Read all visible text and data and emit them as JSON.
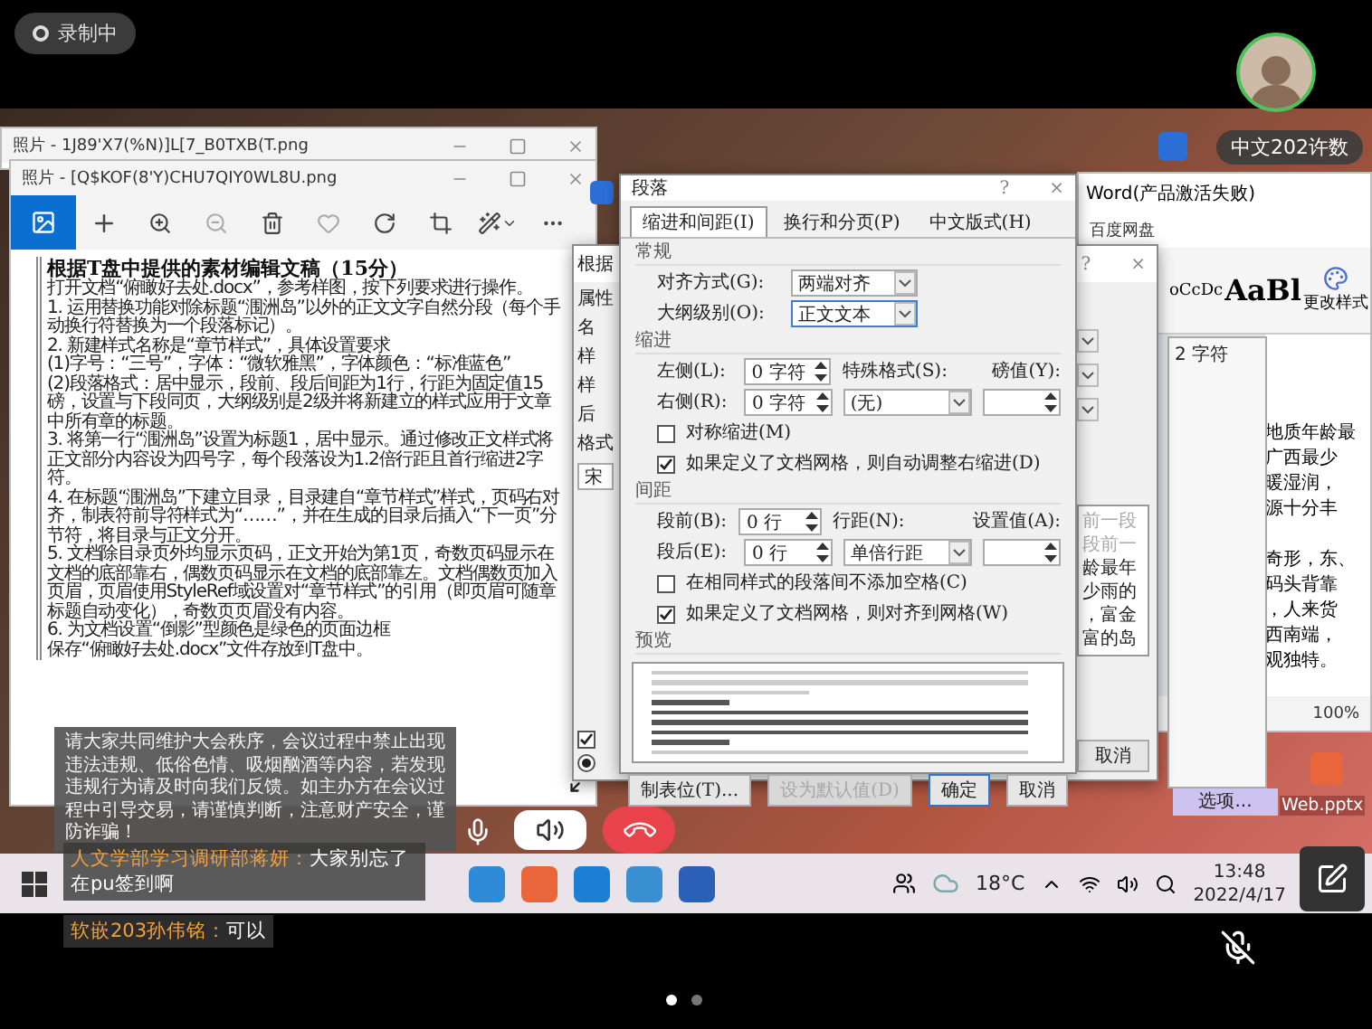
{
  "recording": {
    "label": "录制中"
  },
  "participant": {
    "name": "中文202许数"
  },
  "photo_windows": [
    {
      "title": "照片 - 1J89'X7(%N)]L[7_B0TXB(T.png"
    },
    {
      "title": "照片 - [Q$KOF(8'Y)CHU7QIY0WL8U.png"
    }
  ],
  "document": {
    "heading": "根据T盘中提供的素材编辑文稿（15分）",
    "lines": [
      "打开文档“俯瞰好去处.docx”，参考样图，按下列要求进行操作。",
      "1. 运用替换功能对除标题“涠洲岛”以外的正文文字自然分段（每个手动换行符替换为一个段落标记）。",
      "2. 新建样式名称是“章节样式”，具体设置要求",
      "(1)字号：“三号”，字体：“微软雅黑”，字体颜色：“标准蓝色”",
      "(2)段落格式：居中显示，段前、段后间距为1行，行距为固定值15磅，设置与下段同页，大纲级别是2级并将新建立的样式应用于文章中所有章的标题。",
      "3. 将第一行“涠洲岛”设置为标题1，居中显示。通过修改正文样式将正文部分内容设为四号字，每个段落设为1.2倍行距且首行缩进2字符。",
      "4. 在标题“涠洲岛”下建立目录，目录建自“章节样式”样式，页码右对齐，制表符前导符样式为“……”，并在生成的目录后插入“下一页”分节符，将目录与正文分开。",
      "5. 文档除目录页外均显示页码，正文开始为第1页，奇数页码显示在文档的底部靠右，偶数页码显示在文档的底部靠左。文档偶数页加入页眉，页眉使用StyleRef域设置对“章节样式”的引用（即页眉可随章标题自动变化），奇数页页眉没有内容。",
      "6. 为文档设置“倒影”型颜色是绿色的页面边框",
      "保存“俯瞰好去处.docx”文件存放到T盘中。"
    ]
  },
  "notice": {
    "text": "请大家共同维护大会秩序，会议过程中禁止出现违法违规、低俗色情、吸烟酗酒等内容，若发现违规行为请及时向我们反馈。如主办方在会议过程中引导交易，请谨慎判断，注意财产安全，谨防诈骗！"
  },
  "style_dialog": {
    "title": "根据",
    "labels": [
      "属性",
      "名",
      "样",
      "样",
      "后",
      "格式"
    ],
    "font_value": "宋",
    "help": "?",
    "close": "×",
    "preview_lines": [
      {
        "text": "前一段",
        "muted": true
      },
      {
        "text": "段前一",
        "muted": true
      },
      {
        "text": "龄最年",
        "muted": false
      },
      {
        "text": "少雨的",
        "muted": false
      },
      {
        "text": "，富金",
        "muted": false
      },
      {
        "text": "富的岛",
        "muted": false
      }
    ],
    "add_checked": true,
    "radio_selected": true,
    "cancel": "取消"
  },
  "dialog": {
    "title": "段落",
    "help": "?",
    "close": "×",
    "tabs": [
      {
        "label": "缩进和间距(I)",
        "selected": true
      },
      {
        "label": "换行和分页(P)",
        "selected": false
      },
      {
        "label": "中文版式(H)",
        "selected": false
      }
    ],
    "general": {
      "heading": "常规",
      "alignment": {
        "label": "对齐方式(G):",
        "value": "两端对齐"
      },
      "outline_level": {
        "label": "大纲级别(O):",
        "value": "正文文本"
      }
    },
    "indent": {
      "heading": "缩进",
      "left": {
        "label": "左侧(L):",
        "value": "0 字符"
      },
      "right": {
        "label": "右侧(R):",
        "value": "0 字符"
      },
      "special": {
        "label": "特殊格式(S):",
        "value": "(无)"
      },
      "by": {
        "label": "磅值(Y):"
      },
      "checkboxes": [
        {
          "label": "对称缩进(M)",
          "checked": false
        },
        {
          "label": "如果定义了文档网格，则自动调整右缩进(D)",
          "checked": true
        }
      ]
    },
    "spacing": {
      "heading": "间距",
      "before": {
        "label": "段前(B):",
        "value": "0 行"
      },
      "after": {
        "label": "段后(E):",
        "value": "0 行"
      },
      "line_spacing": {
        "label": "行距(N):",
        "value": "单倍行距"
      },
      "at": {
        "label": "设置值(A):"
      },
      "checkboxes": [
        {
          "label": "在相同样式的段落间不添加空格(C)",
          "checked": false
        },
        {
          "label": "如果定义了文档网格，则对齐到网格(W)",
          "checked": true
        }
      ]
    },
    "preview": {
      "heading": "预览"
    },
    "buttons": [
      {
        "label": "制表位(T)...",
        "disabled": false,
        "default": false
      },
      {
        "label": "设为默认值(D)",
        "disabled": true,
        "default": false
      },
      {
        "label": "确定",
        "disabled": false,
        "default": true
      },
      {
        "label": "取消",
        "disabled": false,
        "default": false
      }
    ]
  },
  "word": {
    "title": "Word(产品激活失败)",
    "ribbon_tab": "百度网盘",
    "styles": [
      "oCcDc",
      "AaBl"
    ],
    "change_styles": "更改样式",
    "pane_value": "2 字符",
    "pane_option": "选项...",
    "zoom": "100%",
    "body_paragraphs": [
      [
        "地质年龄最",
        "广西最少",
        "暖湿润，",
        "源十分丰"
      ],
      [
        "奇形，东、",
        "码头背靠",
        "，人来货",
        "西南端，",
        "观独特。"
      ]
    ]
  },
  "desktop_file": {
    "name": "Web.pptx"
  },
  "chat": [
    {
      "sender": "人文学部学习调研部蒋妍：",
      "text": "大家别忘了在pu签到啊"
    },
    {
      "sender": "软嵌203孙伟铭：",
      "text": "可以"
    }
  ],
  "taskbar": {
    "weather": "18°C",
    "time": "13:48",
    "date": "2022/4/17"
  },
  "pages": [
    {
      "selected": true
    },
    {
      "selected": false
    }
  ]
}
